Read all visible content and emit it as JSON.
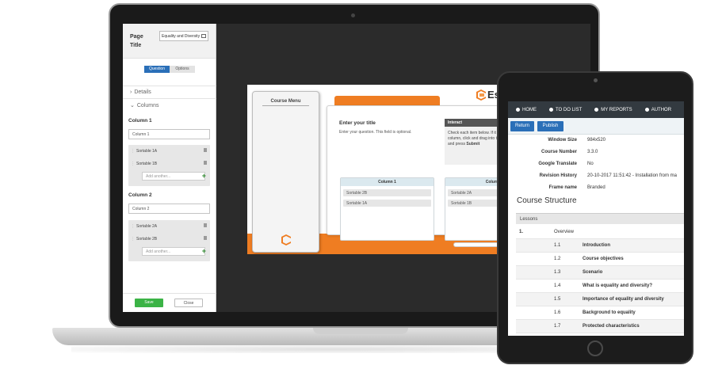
{
  "editor": {
    "page_title_label": "Page Title",
    "page_title_value": "Equality and Diversity",
    "tabs": [
      "Question",
      "Options"
    ],
    "sections": [
      "Details",
      "Columns"
    ],
    "column1": {
      "title": "Column 1",
      "name": "Column 1",
      "items": [
        "Sortable 1A",
        "Sortable 1B"
      ],
      "add_placeholder": "Add another..."
    },
    "column2": {
      "title": "Column 2",
      "name": "Column 2",
      "items": [
        "Sortable 2A",
        "Sortable 2B"
      ],
      "add_placeholder": "Add another..."
    },
    "save_label": "Save",
    "close_label": "Close"
  },
  "course": {
    "menu_title": "Course Menu",
    "brand_text": "Es",
    "question_title": "Enter your title",
    "question_sub": "Enter your question. This field is optional.",
    "interact_label": "Interact",
    "interact_text_1": "Check each item below. If it",
    "interact_text_2": "column, click and drag into t",
    "interact_text_3": "and press",
    "interact_text_bold": "Submit",
    "columns": [
      {
        "header": "Column 1",
        "items": [
          "Sortable 2B",
          "Sortable 1A"
        ]
      },
      {
        "header": "Colum",
        "items": [
          "Sortable 2A",
          "Sortable 1B"
        ]
      }
    ],
    "accent": "#ef7d22"
  },
  "tablet": {
    "nav": [
      "HOME",
      "TO DO LIST",
      "MY REPORTS",
      "AUTHOR"
    ],
    "return_label": "Return",
    "publish_label": "Publish",
    "info": [
      {
        "k": "Window Size",
        "v": "984x520"
      },
      {
        "k": "Course Number",
        "v": "3.3.0"
      },
      {
        "k": "Google Translate",
        "v": "No"
      },
      {
        "k": "Revision History",
        "v": "20-10-2017 11:51:42 - Installation from ma"
      },
      {
        "k": "Frame name",
        "v": "Branded"
      }
    ],
    "structure_title": "Course Structure",
    "lessons_label": "Lessons",
    "lessons": [
      {
        "num": "1.",
        "title": "Overview"
      },
      {
        "num": "1.1",
        "title": "Introduction"
      },
      {
        "num": "1.2",
        "title": "Course objectives"
      },
      {
        "num": "1.3",
        "title": "Scenario"
      },
      {
        "num": "1.4",
        "title": "What is equality and diversity?"
      },
      {
        "num": "1.5",
        "title": "Importance of equality and diversity"
      },
      {
        "num": "1.6",
        "title": "Background to equality"
      },
      {
        "num": "1.7",
        "title": "Protected characteristics"
      }
    ]
  }
}
